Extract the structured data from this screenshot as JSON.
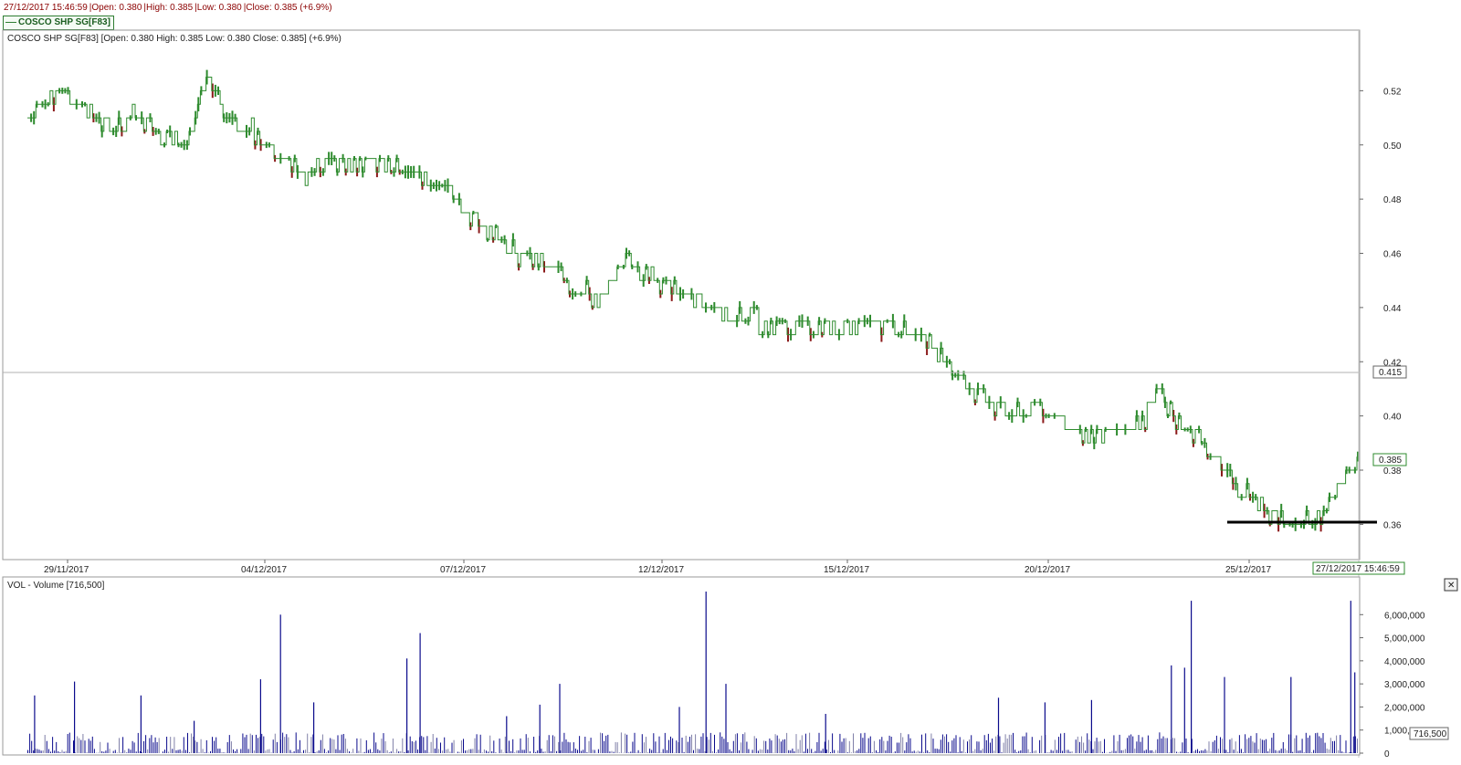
{
  "info_bar": {
    "datetime": "27/12/2017 15:46:59",
    "open": "|Open: 0.380",
    "high": "|High: 0.385",
    "low": "|Low: 0.380",
    "close": "|Close: 0.385 (+6.9%)"
  },
  "series_tag": "COSCO SHP SG[F83]",
  "price_panel": {
    "header": "COSCO SHP SG[F83] [Open: 0.380  High: 0.385  Low: 0.380  Close: 0.385] (+6.9%)",
    "crosshair_label": "0.415",
    "last_price_label": "0.385",
    "time_label": "27/12/2017  15:46:59"
  },
  "volume_panel": {
    "header": "VOL - Volume [716,500]",
    "last_volume_label": "716,500",
    "close_button": "✕"
  },
  "colors": {
    "up": "#1f9a1f",
    "up_body": "#2e8b2e",
    "down": "#8b1a1a",
    "line": "#2e8b2e",
    "volume": "#0a0a8c",
    "crosshair": "#b0b0b0",
    "support": "#000000"
  },
  "chart_data": [
    {
      "type": "line",
      "title": "COSCO SHP SG[F83]",
      "x": [
        "29/11/2017",
        "04/12/2017",
        "07/12/2017",
        "12/12/2017",
        "15/12/2017",
        "20/12/2017",
        "25/12/2017",
        "27/12/2017"
      ],
      "x_ticks": [
        "29/11/2017",
        "04/12/2017",
        "07/12/2017",
        "12/12/2017",
        "15/12/2017",
        "20/12/2017",
        "25/12/2017"
      ],
      "y_ticks": [
        0.36,
        0.38,
        0.4,
        0.42,
        0.44,
        0.46,
        0.48,
        0.5,
        0.52
      ],
      "ylim": [
        0.348,
        0.54
      ],
      "series": [
        {
          "path": [
            [
              0.0,
              0.51
            ],
            [
              0.02,
              0.52
            ],
            [
              0.04,
              0.515
            ],
            [
              0.06,
              0.506
            ],
            [
              0.08,
              0.512
            ],
            [
              0.1,
              0.505
            ],
            [
              0.12,
              0.5
            ],
            [
              0.135,
              0.525
            ],
            [
              0.15,
              0.51
            ],
            [
              0.17,
              0.505
            ],
            [
              0.19,
              0.495
            ],
            [
              0.21,
              0.489
            ],
            [
              0.23,
              0.494
            ],
            [
              0.25,
              0.492
            ],
            [
              0.27,
              0.493
            ],
            [
              0.29,
              0.491
            ],
            [
              0.31,
              0.486
            ],
            [
              0.33,
              0.476
            ],
            [
              0.35,
              0.466
            ],
            [
              0.37,
              0.458
            ],
            [
              0.39,
              0.455
            ],
            [
              0.41,
              0.448
            ],
            [
              0.43,
              0.442
            ],
            [
              0.45,
              0.456
            ],
            [
              0.47,
              0.45
            ],
            [
              0.49,
              0.445
            ],
            [
              0.51,
              0.442
            ],
            [
              0.53,
              0.437
            ],
            [
              0.55,
              0.435
            ],
            [
              0.57,
              0.434
            ],
            [
              0.59,
              0.432
            ],
            [
              0.62,
              0.433
            ],
            [
              0.64,
              0.434
            ],
            [
              0.66,
              0.432
            ],
            [
              0.68,
              0.426
            ],
            [
              0.7,
              0.414
            ],
            [
              0.72,
              0.405
            ],
            [
              0.74,
              0.4
            ],
            [
              0.76,
              0.405
            ],
            [
              0.78,
              0.396
            ],
            [
              0.8,
              0.394
            ],
            [
              0.82,
              0.394
            ],
            [
              0.84,
              0.398
            ],
            [
              0.85,
              0.408
            ],
            [
              0.865,
              0.396
            ],
            [
              0.88,
              0.393
            ],
            [
              0.89,
              0.385
            ],
            [
              0.91,
              0.375
            ],
            [
              0.925,
              0.368
            ],
            [
              0.94,
              0.362
            ],
            [
              0.95,
              0.36
            ],
            [
              0.96,
              0.362
            ],
            [
              0.97,
              0.361
            ],
            [
              0.98,
              0.37
            ],
            [
              1.0,
              0.385
            ]
          ]
        }
      ],
      "annotations": [
        "support line at 0.36"
      ]
    },
    {
      "type": "bar",
      "title": "VOL - Volume",
      "y_ticks": [
        0,
        1000000,
        2000000,
        3000000,
        4000000,
        5000000,
        6000000
      ],
      "y_tick_labels": [
        "0",
        "1,000,000",
        "2,000,000",
        "3,000,000",
        "4,000,000",
        "5,000,000",
        "6,000,000"
      ],
      "ylim": [
        0,
        7000000
      ],
      "last_value": 716500,
      "spikes": [
        [
          0.005,
          2500000
        ],
        [
          0.035,
          3100000
        ],
        [
          0.085,
          2500000
        ],
        [
          0.125,
          1400000
        ],
        [
          0.175,
          3200000
        ],
        [
          0.19,
          6000000
        ],
        [
          0.215,
          2200000
        ],
        [
          0.285,
          4100000
        ],
        [
          0.295,
          5200000
        ],
        [
          0.36,
          1600000
        ],
        [
          0.385,
          2100000
        ],
        [
          0.4,
          3000000
        ],
        [
          0.49,
          2000000
        ],
        [
          0.51,
          7000000
        ],
        [
          0.525,
          3000000
        ],
        [
          0.6,
          1700000
        ],
        [
          0.73,
          2400000
        ],
        [
          0.765,
          2200000
        ],
        [
          0.8,
          2300000
        ],
        [
          0.86,
          3800000
        ],
        [
          0.87,
          3700000
        ],
        [
          0.875,
          6600000
        ],
        [
          0.9,
          3300000
        ],
        [
          0.95,
          3300000
        ],
        [
          0.995,
          6600000
        ],
        [
          0.998,
          3500000
        ]
      ]
    }
  ]
}
